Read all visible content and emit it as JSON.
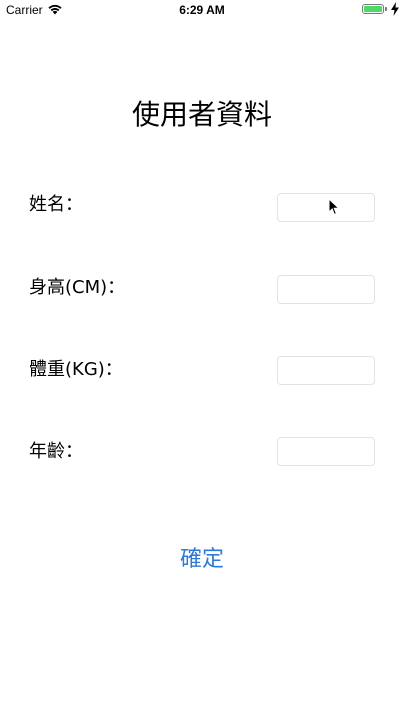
{
  "status_bar": {
    "carrier": "Carrier",
    "time": "6:29 AM",
    "wifi_icon": "wifi-icon",
    "battery_icon": "battery-icon",
    "charging_icon": "charging-bolt-icon",
    "battery_color": "#4cd964"
  },
  "header": {
    "title": "使用者資料"
  },
  "form": {
    "name_label": "姓名：",
    "name_value": "",
    "height_label": "身高(CM)：",
    "height_value": "",
    "weight_label": "體重(KG)：",
    "weight_value": "",
    "age_label": "年齡：",
    "age_value": ""
  },
  "actions": {
    "confirm_label": "確定",
    "accent_color": "#2f7ad6"
  },
  "pointer": {
    "icon": "mouse-pointer-icon"
  }
}
